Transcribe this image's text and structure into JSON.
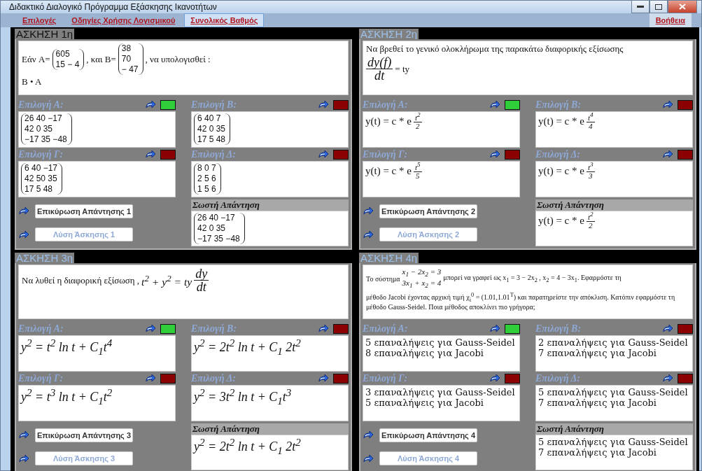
{
  "window": {
    "title": "Διδακτικό Διαλογικό Πρόγραμμα Εξάσκησης Ικανοτήτων"
  },
  "menu": [
    {
      "label": "Επιλογές",
      "selected": false
    },
    {
      "label": "Οδηγίες Χρήσης Λογισμικού",
      "selected": false
    },
    {
      "label": "Συνολικός Βαθμός",
      "selected": true
    }
  ],
  "help_link": "Βοήθεια",
  "exercises": [
    {
      "title": "ΑΣΚΗΣΗ 1η",
      "selected": true,
      "question": [
        [
          {
            "kind": "text",
            "text": "Εάν A="
          },
          {
            "kind": "matrix",
            "rows": [
              "605",
              "15 − 4"
            ]
          },
          {
            "kind": "text",
            "text": ", και B="
          },
          {
            "kind": "matrix",
            "rows": [
              "38",
              "70",
              "− 47"
            ]
          },
          {
            "kind": "text",
            "text": ", να υπολογισθεί :"
          }
        ],
        [
          {
            "kind": "text",
            "text": "B • A"
          }
        ]
      ],
      "options": [
        {
          "label": "Επιλογή Α:",
          "correct": true,
          "content": [
            [
              {
                "kind": "matrix",
                "rows": [
                  "26 40 −17",
                  "42 0 35",
                  "−17 35 −48"
                ]
              }
            ]
          ]
        },
        {
          "label": "Επιλογή Β:",
          "correct": false,
          "content": [
            [
              {
                "kind": "matrix",
                "rows": [
                  "6 40 7",
                  "42 0 35",
                  "17 5 48"
                ]
              }
            ]
          ]
        },
        {
          "label": "Επιλογή Γ:",
          "correct": false,
          "content": [
            [
              {
                "kind": "matrix",
                "rows": [
                  "6 40 −17",
                  "42 50 35",
                  "17 5 48"
                ]
              }
            ]
          ]
        },
        {
          "label": "Επιλογή Δ:",
          "correct": false,
          "content": [
            [
              {
                "kind": "matrix",
                "rows": [
                  "8 0 7",
                  "2 5 6",
                  "1 5 6"
                ]
              }
            ]
          ]
        }
      ],
      "validate_button": {
        "label": "Επικύρωση Απάντησης 1",
        "disabled": false
      },
      "solve_button": {
        "label": "Λύση Άσκησης 1",
        "disabled": true
      },
      "answer_label": "Σωστή Απάντηση",
      "answer": [
        [
          {
            "kind": "matrix",
            "rows": [
              "26 40 −17",
              "42 0 35",
              "−17 35 −48"
            ]
          }
        ]
      ]
    },
    {
      "title": "ΑΣΚΗΣΗ 2η",
      "selected": false,
      "question": [
        [
          {
            "kind": "text",
            "text": "Να βρεθεί το γενικό ολοκλήρωμα της παρακάτω διαφορικής εξίσωσης"
          }
        ],
        [
          {
            "kind": "fraction",
            "num": "dy(f)",
            "den": "dt"
          },
          {
            "kind": "text",
            "text": "= ty"
          }
        ]
      ],
      "options": [
        {
          "label": "Επιλογή Α:",
          "correct": true,
          "content": [
            [
              {
                "kind": "text",
                "text": "y(t) = c * e"
              },
              {
                "kind": "exponent",
                "num": "t$^{2}$",
                "den": "2"
              }
            ]
          ]
        },
        {
          "label": "Επιλογή Β:",
          "correct": false,
          "content": [
            [
              {
                "kind": "text",
                "text": "y(t) = c * e"
              },
              {
                "kind": "exponent",
                "num": "t$^{4}$",
                "den": "4"
              }
            ]
          ]
        },
        {
          "label": "Επιλογή Γ:",
          "correct": false,
          "content": [
            [
              {
                "kind": "text",
                "text": "y(t) = c * e"
              },
              {
                "kind": "exponent",
                "num": "t$^{5}$",
                "den": "5"
              }
            ]
          ]
        },
        {
          "label": "Επιλογή Δ:",
          "correct": false,
          "content": [
            [
              {
                "kind": "text",
                "text": "y(t) = c * e"
              },
              {
                "kind": "exponent",
                "num": "t$^{3}$",
                "den": "3"
              }
            ]
          ]
        }
      ],
      "validate_button": {
        "label": "Επικύρωση Απάντησης 2",
        "disabled": false
      },
      "solve_button": {
        "label": "Λύση Άσκησης 2",
        "disabled": true
      },
      "answer_label": "Σωστή Απάντηση",
      "answer": [
        [
          {
            "kind": "text",
            "text": "y(t) = c * e"
          },
          {
            "kind": "exponent",
            "num": "t$^{2}$",
            "den": "2"
          }
        ]
      ]
    },
    {
      "title": "ΑΣΚΗΣΗ 3η",
      "selected": false,
      "question": [
        [
          {
            "kind": "text",
            "text": "Να λυθεί η διαφορική εξίσωση ,"
          },
          {
            "kind": "formula",
            "text": "t$^{2}$ + y$^{2}$ = ty"
          },
          {
            "kind": "fraction",
            "num": "dy",
            "den": "dt"
          }
        ]
      ],
      "options": [
        {
          "label": "Επιλογή Α:",
          "correct": true,
          "content": [
            [
              {
                "kind": "formula",
                "text": "y$^{2}$ = t$^{2}$ ln t + C$_{1}$t$^{4}$"
              }
            ]
          ]
        },
        {
          "label": "Επιλογή Β:",
          "correct": false,
          "content": [
            [
              {
                "kind": "formula",
                "text": "y$^{2}$ = 2t$^{2}$ ln t + C$_{1}$ 2t$^{2}$"
              }
            ]
          ]
        },
        {
          "label": "Επιλογή Γ:",
          "correct": false,
          "content": [
            [
              {
                "kind": "formula",
                "text": "y$^{2}$ = t$^{3}$ ln t + C$_{1}$t$^{2}$"
              }
            ]
          ]
        },
        {
          "label": "Επιλογή Δ:",
          "correct": false,
          "content": [
            [
              {
                "kind": "formula",
                "text": "y$^{2}$ = 3t$^{2}$ ln t + C$_{1}$t$^{3}$"
              }
            ]
          ]
        }
      ],
      "validate_button": {
        "label": "Επικύρωση Απάντησης 3",
        "disabled": false
      },
      "solve_button": {
        "label": "Λύση Άσκησης 3",
        "disabled": true
      },
      "answer_label": "Σωστή Απάντηση",
      "answer": [
        [
          {
            "kind": "formula",
            "text": "y$^{2}$ = 2t$^{2}$ ln t + C$_{1}$ 2t$^{2}$"
          }
        ]
      ]
    },
    {
      "title": "ΑΣΚΗΣΗ 4η",
      "selected": false,
      "question": [
        [
          {
            "kind": "text",
            "text": "Το σύστημα"
          },
          {
            "kind": "system",
            "rows": [
              "x$_{1}$ − 2x$_{2}$ = 3",
              "3x$_{1}$ + x$_{2}$ = 4"
            ]
          },
          {
            "kind": "text",
            "text": "μπορεί να γραφεί ως x$_{1}$ = 3 − 2x$_{2}$ , x$_{2}$ = 4 − 3x$_{1}$. Εφαρμόστε τη"
          }
        ],
        [
          {
            "kind": "text",
            "text": "μέθοδο Jacobi έχοντας αρχική τιμή χ$_{i}$$^{0}$ = (1.01,1.01$^{T}$) και παρατηρείστε την απόκλιση. Κατόπιν εφαρμόστε τη μέθοδο Gauss-Seidel. Ποια μέθοδος αποκλίνει πιο γρήγορα;"
          }
        ]
      ],
      "options": [
        {
          "label": "Επιλογή Α:",
          "correct": true,
          "content": [
            [
              {
                "kind": "line",
                "text": "5 επαναλήψεις για Gauss-Seidel"
              }
            ],
            [
              {
                "kind": "line",
                "text": "8 επαναλήψεις για Jacobi"
              }
            ]
          ]
        },
        {
          "label": "Επιλογή Β:",
          "correct": false,
          "content": [
            [
              {
                "kind": "line",
                "text": "2 επαναλήψεις για Gauss-Seidel"
              }
            ],
            [
              {
                "kind": "line",
                "text": "7 επαναλήψεις για Jacobi"
              }
            ]
          ]
        },
        {
          "label": "Επιλογή Γ:",
          "correct": false,
          "content": [
            [
              {
                "kind": "line",
                "text": "3 επαναλήψεις για Gauss-Seidel"
              }
            ],
            [
              {
                "kind": "line",
                "text": "5 επαναλήψεις για Jacobi"
              }
            ]
          ]
        },
        {
          "label": "Επιλογή Δ:",
          "correct": false,
          "content": [
            [
              {
                "kind": "line",
                "text": "5 επαναλήψεις για Gauss-Seidel"
              }
            ],
            [
              {
                "kind": "line",
                "text": "7 επαναλήψεις για Jacobi"
              }
            ]
          ]
        }
      ],
      "validate_button": {
        "label": "Επικύρωση Απάντησης 4",
        "disabled": false
      },
      "solve_button": {
        "label": "Λύση Άσκησης 4",
        "disabled": true
      },
      "answer_label": "Σωστή Απάντηση",
      "answer": [
        [
          {
            "kind": "line",
            "text": "5 επαναλήψεις για Gauss-Seidel"
          }
        ],
        [
          {
            "kind": "line",
            "text": "7 επαναλήψεις για Jacobi"
          }
        ]
      ]
    }
  ]
}
